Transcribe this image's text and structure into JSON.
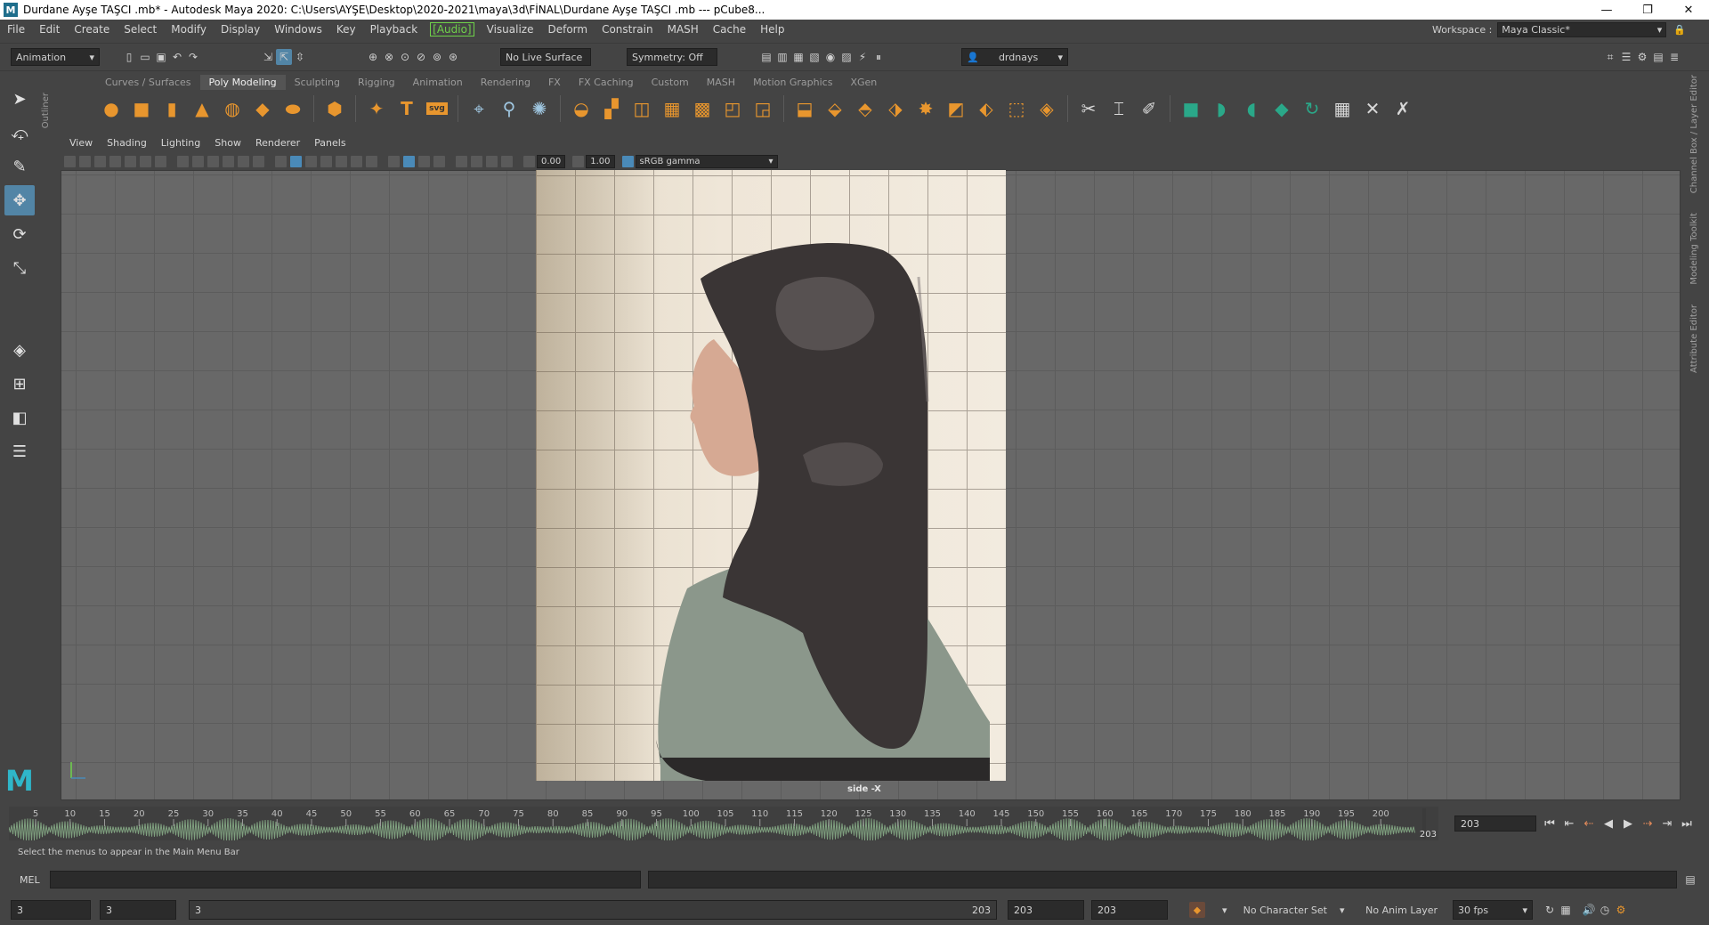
{
  "window": {
    "title": "Durdane Ayşe TAŞCI .mb* - Autodesk Maya 2020: C:\\Users\\AYŞE\\Desktop\\2020-2021\\maya\\3d\\FİNAL\\Durdane Ayşe TAŞCI .mb  ---  pCube8...",
    "minimize": "—",
    "restore": "❐",
    "close": "✕"
  },
  "menu": {
    "items": [
      "File",
      "Edit",
      "Create",
      "Select",
      "Modify",
      "Display",
      "Windows",
      "Key",
      "Playback",
      "[Audio]",
      "Visualize",
      "Deform",
      "Constrain",
      "MASH",
      "Cache",
      "Help"
    ],
    "workspace_label": "Workspace :",
    "workspace_value": "Maya Classic*"
  },
  "statusline": {
    "menuset": "Animation",
    "live_surface": "No Live Surface",
    "symmetry": "Symmetry: Off",
    "user": "drdnays"
  },
  "shelf": {
    "tabs": [
      "Curves / Surfaces",
      "Poly Modeling",
      "Sculpting",
      "Rigging",
      "Animation",
      "Rendering",
      "FX",
      "FX Caching",
      "Custom",
      "MASH",
      "Motion Graphics",
      "XGen"
    ],
    "active_tab": "Poly Modeling",
    "icon_text": "T",
    "svg_text": "svg"
  },
  "outliner_label": "Outliner",
  "panel": {
    "menus": [
      "View",
      "Shading",
      "Lighting",
      "Show",
      "Renderer",
      "Panels"
    ],
    "exposure": "0.00",
    "gamma": "1.00",
    "color_space": "sRGB gamma",
    "camera": "side -X"
  },
  "timeline": {
    "ticks": [
      "5",
      "10",
      "15",
      "20",
      "25",
      "30",
      "35",
      "40",
      "45",
      "50",
      "55",
      "60",
      "65",
      "70",
      "75",
      "80",
      "85",
      "90",
      "95",
      "100",
      "105",
      "110",
      "115",
      "120",
      "125",
      "130",
      "135",
      "140",
      "145",
      "150",
      "155",
      "160",
      "165",
      "170",
      "175",
      "180",
      "185",
      "190",
      "195",
      "200"
    ],
    "end_marker": "203",
    "current_frame": "203"
  },
  "helpline": "Select the menus to appear in the Main Menu Bar",
  "commandline": {
    "lang": "MEL"
  },
  "range": {
    "start": "3",
    "playback_start": "3",
    "slider_start": "3",
    "slider_end": "203",
    "playback_end": "203",
    "end": "203",
    "character_set": "No Character Set",
    "anim_layer": "No Anim Layer",
    "fps": "30 fps"
  },
  "right_tabs": [
    "Channel Box / Layer Editor",
    "Modeling Toolkit",
    "Attribute Editor"
  ],
  "colors": {
    "background": "#444444",
    "viewport": "#686868",
    "active_tool": "#5285a6",
    "audio_green": "#6fd24a",
    "shelf_orange": "#e8962e",
    "shelf_teal": "#2aa889",
    "waveform": "#7fa07f"
  }
}
